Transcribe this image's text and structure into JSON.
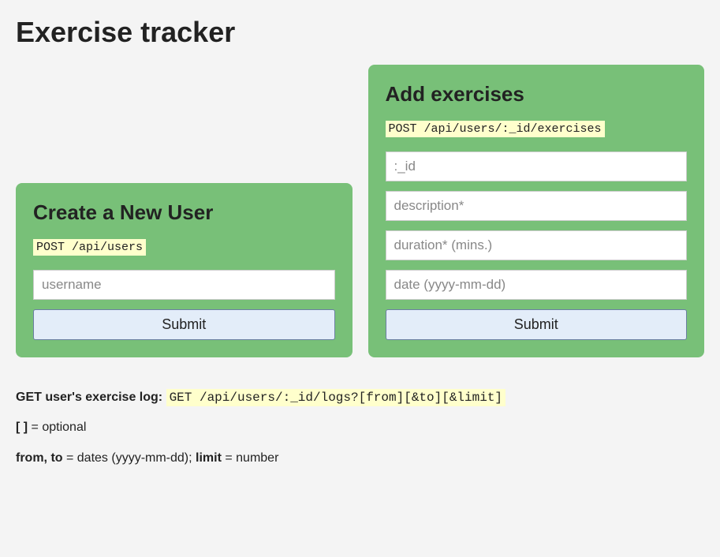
{
  "page_title": "Exercise tracker",
  "create_user": {
    "heading": "Create a New User",
    "endpoint": "POST /api/users",
    "username_placeholder": "username",
    "submit_label": "Submit"
  },
  "add_exercises": {
    "heading": "Add exercises",
    "endpoint": "POST /api/users/:_id/exercises",
    "id_placeholder": ":_id",
    "description_placeholder": "description*",
    "duration_placeholder": "duration* (mins.)",
    "date_placeholder": "date (yyyy-mm-dd)",
    "submit_label": "Submit"
  },
  "info": {
    "get_log_label": "GET user's exercise log: ",
    "get_log_endpoint": "GET /api/users/:_id/logs?[from][&to][&limit]",
    "optional_label": "[ ]",
    "optional_text": " = optional",
    "fromto_label": "from, to",
    "fromto_text": " = dates (yyyy-mm-dd); ",
    "limit_label": "limit",
    "limit_text": " = number"
  }
}
